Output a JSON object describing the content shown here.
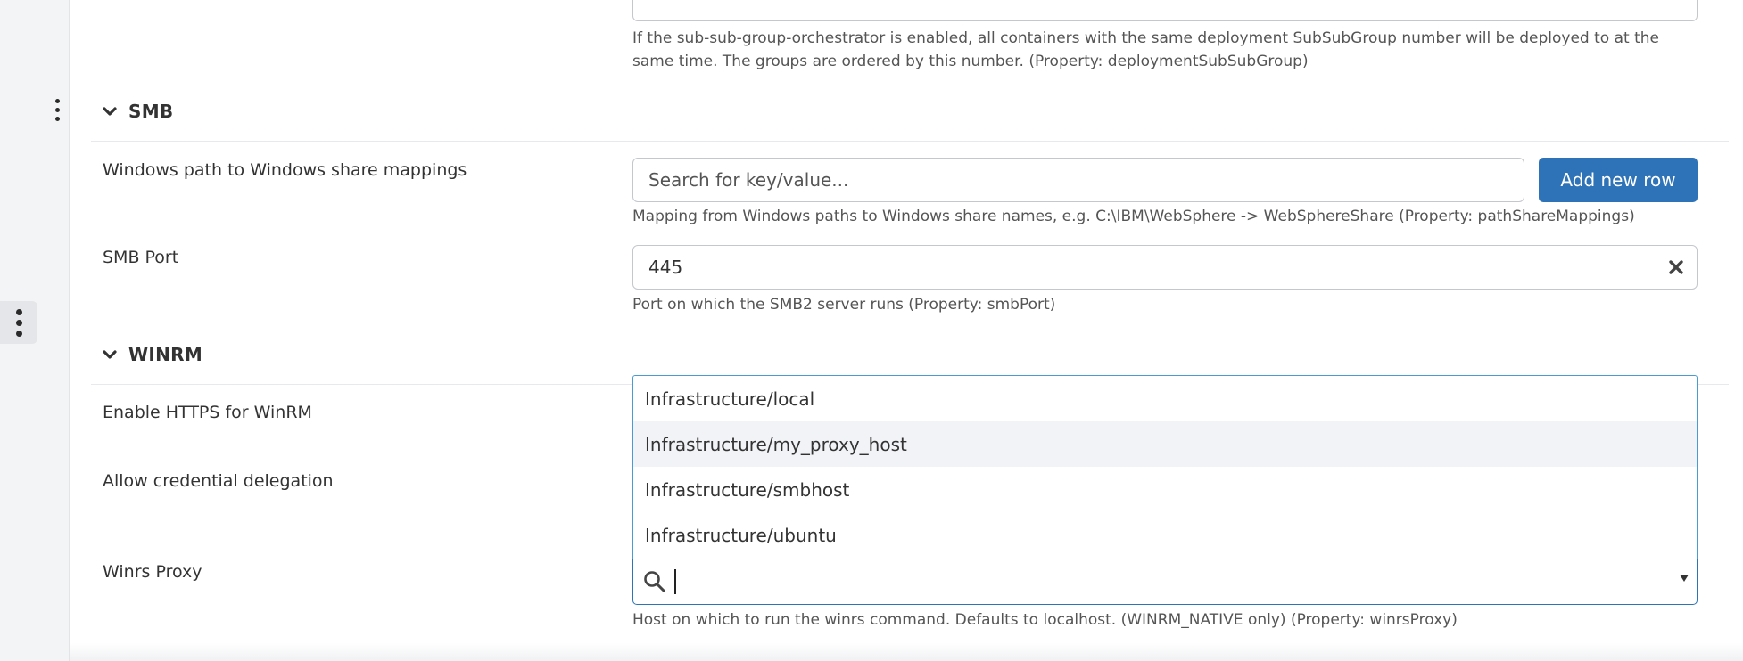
{
  "sections": {
    "smb": {
      "title": "SMB"
    },
    "winrm": {
      "title": "WINRM"
    }
  },
  "top_field": {
    "help": "If the sub-sub-group-orchestrator is enabled, all containers with the same deployment SubSubGroup number will be deployed to at the same time. The groups are ordered by this number. (Property: deploymentSubSubGroup)"
  },
  "share_mappings": {
    "label": "Windows path to Windows share mappings",
    "placeholder": "Search for key/value...",
    "add_button": "Add new row",
    "help": "Mapping from Windows paths to Windows share names, e.g. C:\\IBM\\WebSphere -> WebSphereShare (Property: pathShareMappings)"
  },
  "smb_port": {
    "label": "SMB Port",
    "value": "445",
    "help": "Port on which the SMB2 server runs (Property: smbPort)"
  },
  "winrm_https": {
    "label": "Enable HTTPS for WinRM"
  },
  "credential_delegation": {
    "label": "Allow credential delegation"
  },
  "winrs_proxy": {
    "label": "Winrs Proxy",
    "search_value": "",
    "options": [
      "Infrastructure/local",
      "Infrastructure/my_proxy_host",
      "Infrastructure/smbhost",
      "Infrastructure/ubuntu"
    ],
    "highlighted_index": 1,
    "help": "Host on which to run the winrs command. Defaults to localhost. (WINRM_NATIVE only) (Property: winrsProxy)"
  },
  "icons": {
    "chevron": "chevron-down-icon",
    "clear": "clear-icon",
    "search": "search-icon",
    "dropdown": "dropdown-arrow-icon",
    "menu": "vertical-dots-icon"
  },
  "colors": {
    "primary": "#2e73b8",
    "focus": "#4a9ad4",
    "highlight_row": "#f2f3f7",
    "rail": "#f3f4f6"
  }
}
